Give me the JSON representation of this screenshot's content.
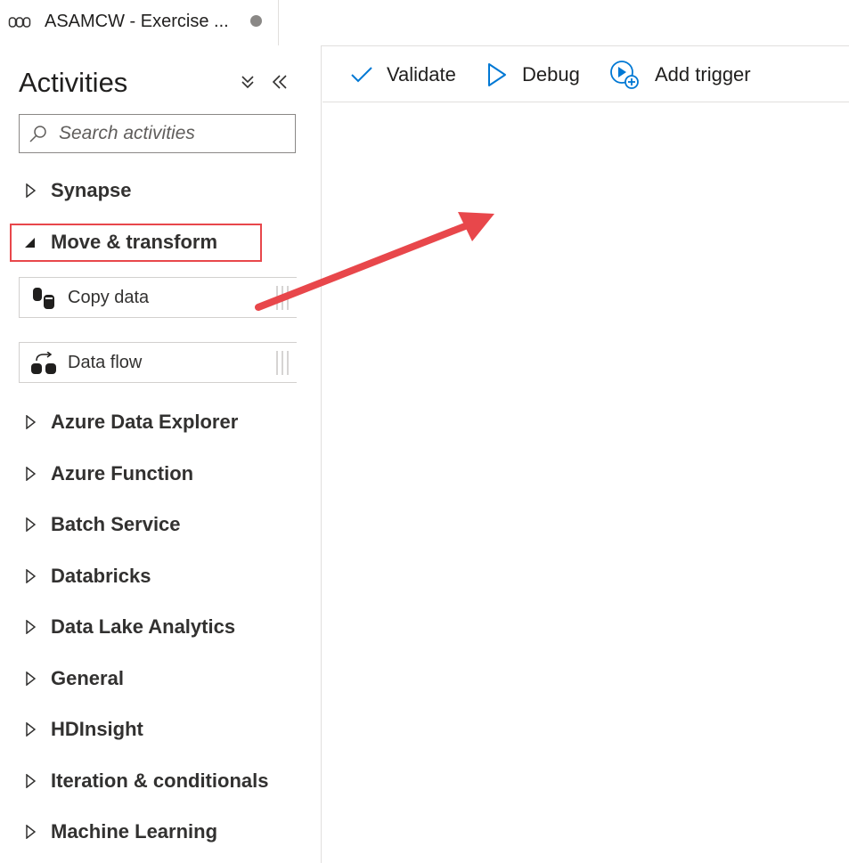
{
  "tab": {
    "title": "ASAMCW - Exercise ..."
  },
  "sidebar": {
    "title": "Activities",
    "search_placeholder": "Search activities",
    "categories": [
      {
        "label": "Synapse",
        "expanded": false
      },
      {
        "label": "Move & transform",
        "expanded": true
      },
      {
        "label": "Azure Data Explorer",
        "expanded": false
      },
      {
        "label": "Azure Function",
        "expanded": false
      },
      {
        "label": "Batch Service",
        "expanded": false
      },
      {
        "label": "Databricks",
        "expanded": false
      },
      {
        "label": "Data Lake Analytics",
        "expanded": false
      },
      {
        "label": "General",
        "expanded": false
      },
      {
        "label": "HDInsight",
        "expanded": false
      },
      {
        "label": "Iteration & conditionals",
        "expanded": false
      },
      {
        "label": "Machine Learning",
        "expanded": false
      }
    ],
    "activities": [
      {
        "label": "Copy data",
        "icon": "copy-data-icon"
      },
      {
        "label": "Data flow",
        "icon": "data-flow-icon"
      }
    ]
  },
  "toolbar": {
    "validate_label": "Validate",
    "debug_label": "Debug",
    "add_trigger_label": "Add trigger"
  },
  "colors": {
    "accent": "#0078d4",
    "highlight": "#e8474b",
    "arrow": "#e8474b"
  }
}
